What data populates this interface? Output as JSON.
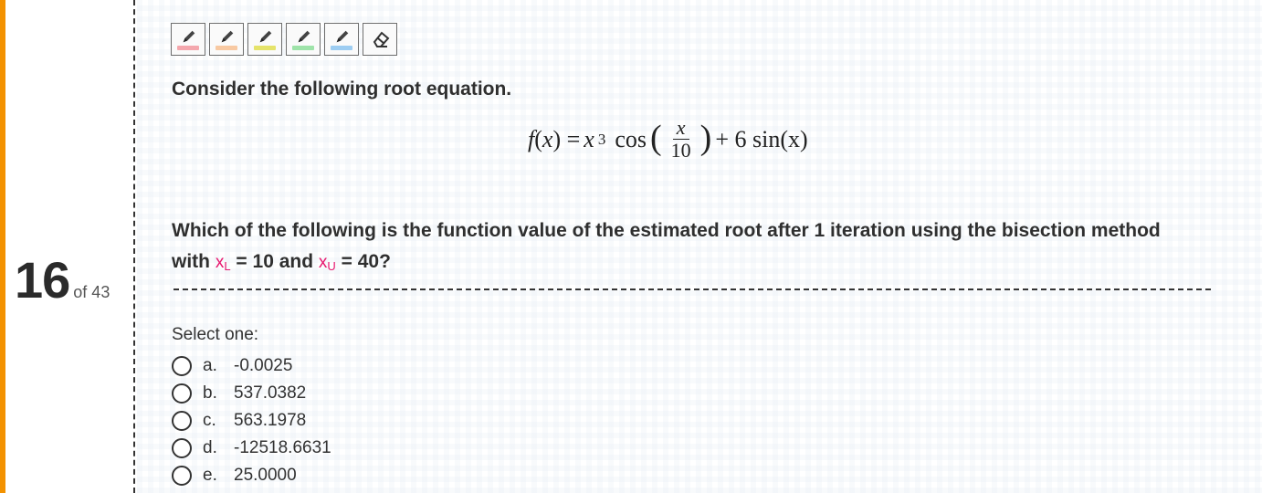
{
  "question_number": {
    "current": "16",
    "total_text": "of 43"
  },
  "toolbar": {
    "tools": [
      {
        "icon": "pencil-icon",
        "swatch_color": "#f4a7ad"
      },
      {
        "icon": "pencil-icon",
        "swatch_color": "#f8c9a2"
      },
      {
        "icon": "pencil-icon",
        "swatch_color": "#e5e36a"
      },
      {
        "icon": "pencil-icon",
        "swatch_color": "#9ee3a9"
      },
      {
        "icon": "pencil-icon",
        "swatch_color": "#9dcdf2"
      },
      {
        "icon": "eraser-icon",
        "swatch_color": ""
      }
    ]
  },
  "question": {
    "intro": "Consider the following root equation.",
    "equation": {
      "lhs": "f(x) =",
      "term1": "x",
      "exp": "3",
      "cos": "cos",
      "frac_num": "x",
      "frac_den": "10",
      "rest": "+ 6 sin(x)"
    },
    "line1": "Which of the following is the function value of the estimated root after 1 iteration using the bisection method",
    "line2_prefix": "with",
    "xl_var": "x",
    "xl_sub": "L",
    "xl_value": "= 10 and",
    "xu_var": "x",
    "xu_sub": "U",
    "xu_value": "= 40?"
  },
  "select_label": "Select one:",
  "options": [
    {
      "letter": "a.",
      "value": "-0.0025"
    },
    {
      "letter": "b.",
      "value": "537.0382"
    },
    {
      "letter": "c.",
      "value": "563.1978"
    },
    {
      "letter": "d.",
      "value": "-12518.6631"
    },
    {
      "letter": "e.",
      "value": "25.0000"
    }
  ],
  "colors": {
    "accent": "#f39200",
    "variable": "#e7166e"
  }
}
